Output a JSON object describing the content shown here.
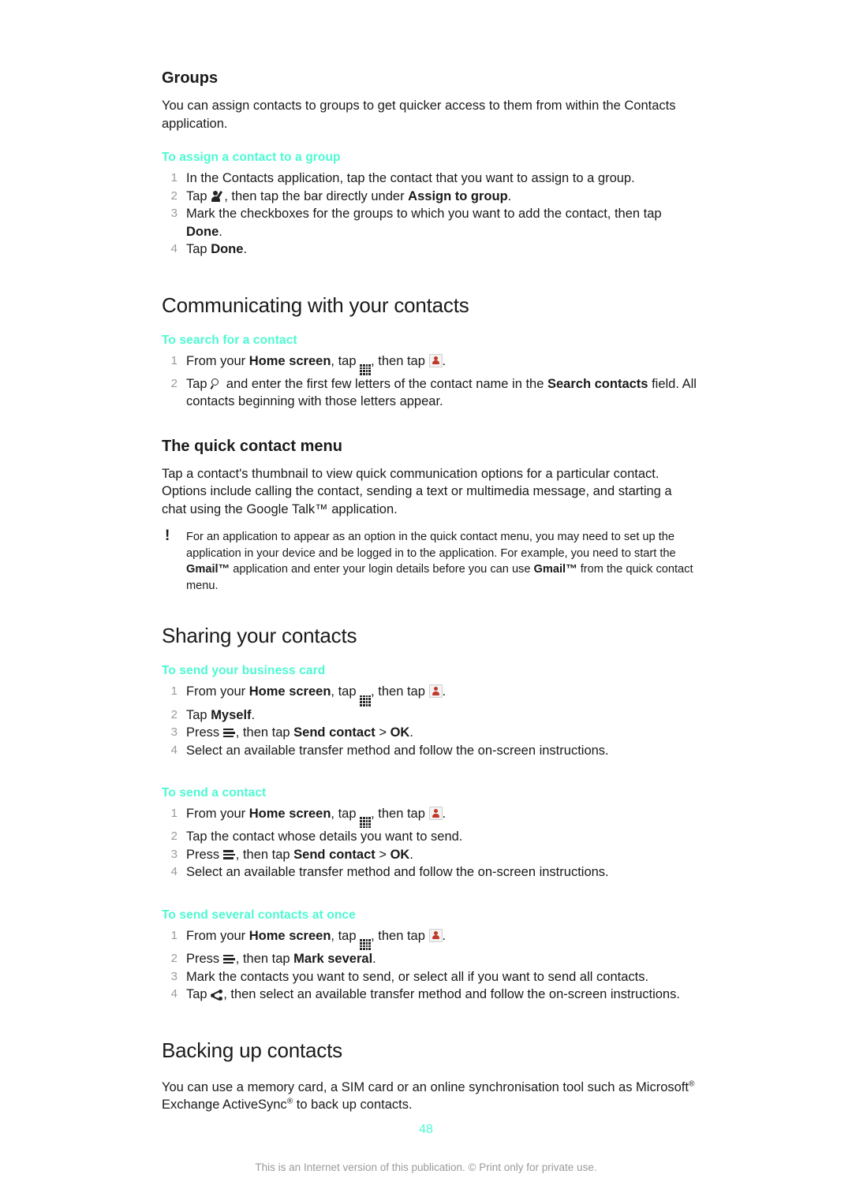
{
  "document": {
    "page_number": "48",
    "footer_note": "This is an Internet version of this publication. © Print only for private use.",
    "accent_color": "#4dfad2",
    "text_color": "#1a1a1a",
    "step_number_color": "#9a9a9a"
  },
  "sections": {
    "groups": {
      "heading": "Groups",
      "intro": "You can assign contacts to groups to get quicker access to them from within the Contacts application.",
      "task": {
        "title": "To assign a contact to a group",
        "steps": [
          {
            "num": "1",
            "pre": "In the Contacts application, tap the contact that you want to assign to a group.",
            "post": ""
          },
          {
            "num": "2",
            "pre": "Tap ",
            "icon": "person-edit-icon",
            "mid": ", then tap the bar directly under ",
            "bold": "Assign to group",
            "post": "."
          },
          {
            "num": "3",
            "pre": "Mark the checkboxes for the groups to which you want to add the contact, then tap ",
            "bold": "Done",
            "post": "."
          },
          {
            "num": "4",
            "pre": "Tap ",
            "bold": "Done",
            "post": "."
          }
        ]
      }
    },
    "communicating": {
      "heading": "Communicating with your contacts",
      "task_search": {
        "title": "To search for a contact",
        "step1": {
          "num": "1",
          "pre": "From your ",
          "bold1": "Home screen",
          "mid1": ", tap ",
          "icon1": "app-grid-icon",
          "mid2": ", then tap ",
          "icon2": "contacts-app-icon",
          "post": "."
        },
        "step2": {
          "num": "2",
          "pre": "Tap ",
          "icon": "search-icon",
          "mid": " and enter the first few letters of the contact name in the ",
          "bold": "Search contacts",
          "post": " field. All contacts beginning with those letters appear."
        }
      },
      "quick_contact_menu": {
        "heading": "The quick contact menu",
        "body": "Tap a contact's thumbnail to view quick communication options for a particular contact. Options include calling the contact, sending a text or multimedia message, and starting a chat using the Google Talk™ application.",
        "note": {
          "icon": "exclamation-icon",
          "part1": "For an application to appear as an option in the quick contact menu, you may need to set up the application in your device and be logged in to the application. For example, you need to start the ",
          "bold1": "Gmail™",
          "part2": " application and enter your login details before you can use ",
          "bold2": "Gmail™",
          "part3": " from the quick contact menu."
        }
      }
    },
    "sharing": {
      "heading": "Sharing your contacts",
      "task_business_card": {
        "title": "To send your business card",
        "steps": [
          {
            "num": "1",
            "type": "home",
            "pre": "From your ",
            "bold1": "Home screen",
            "mid1": ", tap ",
            "mid2": ", then tap ",
            "post": "."
          },
          {
            "num": "2",
            "type": "plain_bold",
            "pre": "Tap ",
            "bold": "Myself",
            "post": "."
          },
          {
            "num": "3",
            "type": "press_menu",
            "pre": "Press ",
            "mid": ", then tap ",
            "bold": "Send contact",
            "mid2": " > ",
            "bold2": "OK",
            "post": "."
          },
          {
            "num": "4",
            "type": "plain",
            "pre": "Select an available transfer method and follow the on-screen instructions.",
            "post": ""
          }
        ]
      },
      "task_send_contact": {
        "title": "To send a contact",
        "steps": [
          {
            "num": "1",
            "type": "home",
            "pre": "From your ",
            "bold1": "Home screen",
            "mid1": ", tap ",
            "mid2": ", then tap ",
            "post": "."
          },
          {
            "num": "2",
            "type": "plain",
            "pre": "Tap the contact whose details you want to send.",
            "post": ""
          },
          {
            "num": "3",
            "type": "press_menu",
            "pre": "Press ",
            "mid": ", then tap ",
            "bold": "Send contact",
            "mid2": " > ",
            "bold2": "OK",
            "post": "."
          },
          {
            "num": "4",
            "type": "plain",
            "pre": "Select an available transfer method and follow the on-screen instructions.",
            "post": ""
          }
        ]
      },
      "task_send_several": {
        "title": "To send several contacts at once",
        "steps": [
          {
            "num": "1",
            "type": "home",
            "pre": "From your ",
            "bold1": "Home screen",
            "mid1": ", tap ",
            "mid2": ", then tap ",
            "post": "."
          },
          {
            "num": "2",
            "type": "press_menu_simple",
            "pre": "Press ",
            "mid": ", then tap ",
            "bold": "Mark several",
            "post": "."
          },
          {
            "num": "3",
            "type": "plain",
            "pre": "Mark the contacts you want to send, or select all if you want to send all contacts.",
            "post": ""
          },
          {
            "num": "4",
            "type": "share",
            "pre": "Tap ",
            "post": ", then select an available transfer method and follow the on-screen instructions."
          }
        ]
      }
    },
    "backing_up": {
      "heading": "Backing up contacts",
      "body_part1": "You can use a memory card, a SIM card or an online synchronisation tool such as Microsoft",
      "sup1": "®",
      "body_part2": " Exchange ActiveSync",
      "sup2": "®",
      "body_part3": " to back up contacts."
    }
  }
}
